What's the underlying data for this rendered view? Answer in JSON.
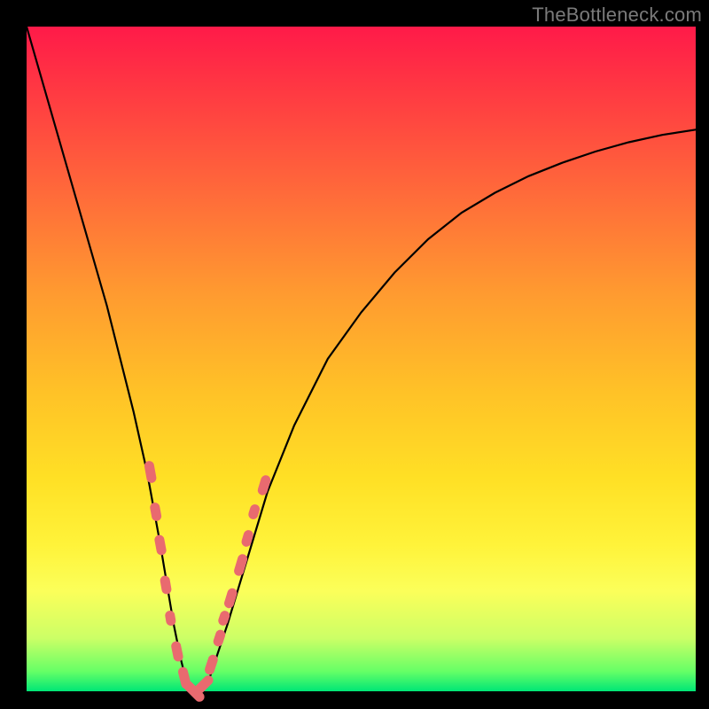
{
  "watermark": "TheBottleneck.com",
  "colors": {
    "bead": "#e96a6f",
    "curve": "#000000",
    "frame": "#000000"
  },
  "chart_data": {
    "type": "line",
    "title": "",
    "xlabel": "",
    "ylabel": "",
    "xlim": [
      0,
      100
    ],
    "ylim": [
      0,
      100
    ],
    "grid": false,
    "legend": false,
    "annotations": [
      "TheBottleneck.com"
    ],
    "series": [
      {
        "name": "bottleneck-curve",
        "x": [
          0,
          2,
          4,
          6,
          8,
          10,
          12,
          14,
          16,
          18,
          20,
          21,
          22,
          23,
          24,
          25,
          26,
          27,
          28,
          30,
          33,
          36,
          40,
          45,
          50,
          55,
          60,
          65,
          70,
          75,
          80,
          85,
          90,
          95,
          100
        ],
        "y": [
          100,
          93,
          86,
          79,
          72,
          65,
          58,
          50,
          42,
          33,
          22,
          16,
          10,
          5,
          1,
          0,
          0,
          1,
          4,
          10,
          20,
          30,
          40,
          50,
          57,
          63,
          68,
          72,
          75,
          77.5,
          79.5,
          81.2,
          82.6,
          83.7,
          84.5
        ]
      }
    ],
    "markers": {
      "name": "beads",
      "description": "salmon capsule markers clustered near the valley",
      "points": [
        {
          "x": 18.5,
          "y": 33,
          "len": 7
        },
        {
          "x": 19.3,
          "y": 27,
          "len": 5
        },
        {
          "x": 20.0,
          "y": 22,
          "len": 6
        },
        {
          "x": 20.8,
          "y": 16,
          "len": 5
        },
        {
          "x": 21.5,
          "y": 11,
          "len": 3
        },
        {
          "x": 22.5,
          "y": 6,
          "len": 6
        },
        {
          "x": 23.6,
          "y": 2,
          "len": 7
        },
        {
          "x": 25.0,
          "y": 0,
          "len": 9
        },
        {
          "x": 26.5,
          "y": 1,
          "len": 7
        },
        {
          "x": 27.6,
          "y": 4,
          "len": 6
        },
        {
          "x": 28.8,
          "y": 8,
          "len": 4
        },
        {
          "x": 29.5,
          "y": 11,
          "len": 3
        },
        {
          "x": 30.5,
          "y": 14,
          "len": 6
        },
        {
          "x": 32.0,
          "y": 19,
          "len": 7
        },
        {
          "x": 33.0,
          "y": 23,
          "len": 4
        },
        {
          "x": 34.0,
          "y": 27,
          "len": 3
        },
        {
          "x": 35.5,
          "y": 31,
          "len": 6
        }
      ]
    }
  }
}
